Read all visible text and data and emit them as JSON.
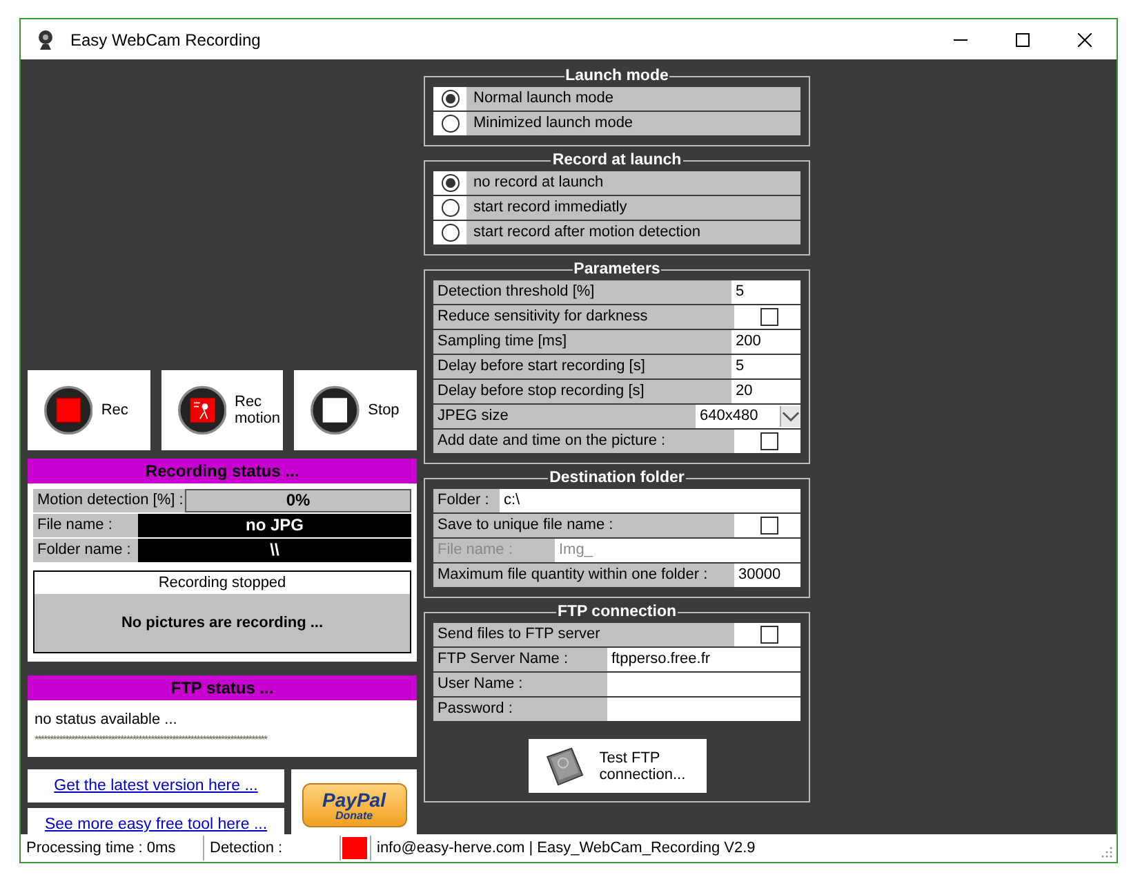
{
  "window": {
    "title": "Easy WebCam Recording"
  },
  "record_buttons": [
    {
      "kind": "rec",
      "label": "Rec"
    },
    {
      "kind": "motion",
      "label": "Rec motion"
    },
    {
      "kind": "stop",
      "label": "Stop"
    }
  ],
  "recording_status": {
    "title": "Recording status ...",
    "motion_label": "Motion detection [%] :",
    "motion_value": "0%",
    "file_label": "File name :",
    "file_value": "no JPG",
    "folder_label": "Folder name :",
    "folder_value": "\\\\",
    "state": "Recording stopped",
    "message": "No pictures are recording ..."
  },
  "ftp_status": {
    "title": "FTP status ...",
    "message": "no status available ...",
    "dots": "****************************************************************************"
  },
  "links": [
    "Get the latest version here ...",
    "See more easy free tool here ..."
  ],
  "paypal": {
    "brand": "PayPal",
    "action": "Donate"
  },
  "launch_mode": {
    "title": "Launch mode",
    "options": [
      {
        "label": "Normal launch mode",
        "selected": true
      },
      {
        "label": "Minimized launch mode",
        "selected": false
      }
    ]
  },
  "record_at_launch": {
    "title": "Record at launch",
    "options": [
      {
        "label": "no record at launch",
        "selected": true
      },
      {
        "label": "start record immediatly",
        "selected": false
      },
      {
        "label": "start record after motion detection",
        "selected": false
      }
    ]
  },
  "parameters": {
    "title": "Parameters",
    "rows": [
      {
        "kind": "text",
        "label": "Detection threshold [%]",
        "value": "5"
      },
      {
        "kind": "checkbox",
        "label": "Reduce sensitivity for darkness",
        "checked": false
      },
      {
        "kind": "text",
        "label": "Sampling time [ms]",
        "value": "200"
      },
      {
        "kind": "text",
        "label": "Delay before start recording [s]",
        "value": "5"
      },
      {
        "kind": "text",
        "label": "Delay before stop recording [s]",
        "value": "20"
      },
      {
        "kind": "select",
        "label": "JPEG size",
        "value": "640x480"
      },
      {
        "kind": "checkbox",
        "label": "Add date and time on the picture :",
        "checked": false
      }
    ]
  },
  "destination_folder": {
    "title": "Destination folder",
    "rows": [
      {
        "kind": "folder",
        "label": "Folder :",
        "value": "c:\\"
      },
      {
        "kind": "checkbox",
        "label": "Save to unique file name :",
        "checked": false
      },
      {
        "kind": "text",
        "label": "File name :",
        "value": "Img_",
        "disabled": true
      },
      {
        "kind": "text",
        "label": "Maximum file quantity within one folder :",
        "value": "30000",
        "disabled": false
      }
    ]
  },
  "ftp_connection": {
    "title": "FTP connection",
    "rows": [
      {
        "kind": "checkbox",
        "label": "Send files to FTP server",
        "checked": false
      },
      {
        "kind": "text",
        "label": "FTP Server Name :",
        "value": "ftpperso.free.fr"
      },
      {
        "kind": "text",
        "label": "User Name :",
        "value": ""
      },
      {
        "kind": "text",
        "label": "Password :",
        "value": ""
      }
    ],
    "test_button": "Test FTP connection..."
  },
  "status_bar": {
    "processing": "Processing time : 0ms",
    "detection": "Detection :",
    "info": "info@easy-herve.com  |  Easy_WebCam_Recording V2.9"
  }
}
